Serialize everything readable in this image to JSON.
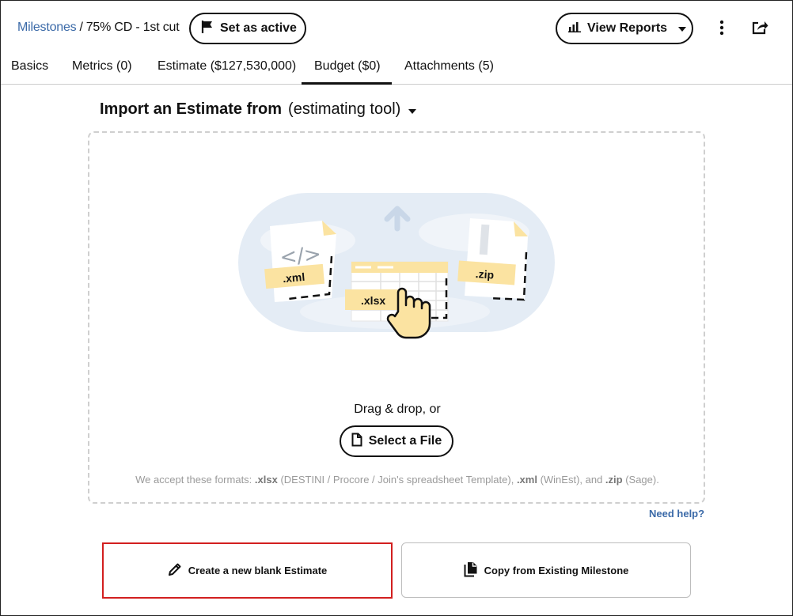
{
  "header": {
    "breadcrumb_link": "Milestones",
    "breadcrumb_sep": "/",
    "breadcrumb_current": "75% CD - 1st cut",
    "set_active_label": "Set as active",
    "view_reports_label": "View Reports"
  },
  "tabs": [
    {
      "label": "Basics"
    },
    {
      "label": "Metrics (0)"
    },
    {
      "label": "Estimate ($127,530,000)"
    },
    {
      "label": "Budget ($0)",
      "active": true
    },
    {
      "label": "Attachments (5)"
    }
  ],
  "import": {
    "title": "Import an Estimate from",
    "tool_label": "(estimating tool)",
    "file_labels": {
      "xml": ".xml",
      "xlsx": ".xlsx",
      "zip": ".zip"
    },
    "drag_text": "Drag & drop, or",
    "select_file_label": "Select a File",
    "formats": {
      "prefix": "We accept these formats: ",
      "xlsx": ".xlsx",
      "xlsx_desc": " (DESTINI / Procore / Join's spreadsheet Template), ",
      "xml": ".xml",
      "xml_desc": " (WinEst), and ",
      "zip": ".zip",
      "zip_desc": " (Sage)."
    },
    "need_help": "Need help?"
  },
  "actions": {
    "create_blank": "Create a new blank Estimate",
    "copy_existing": "Copy from Existing Milestone"
  },
  "colors": {
    "link": "#3b6aa8",
    "highlight_border": "#d21f1f",
    "file_tag": "#fbe3a1",
    "cloud_bg": "#e4ecf5"
  }
}
